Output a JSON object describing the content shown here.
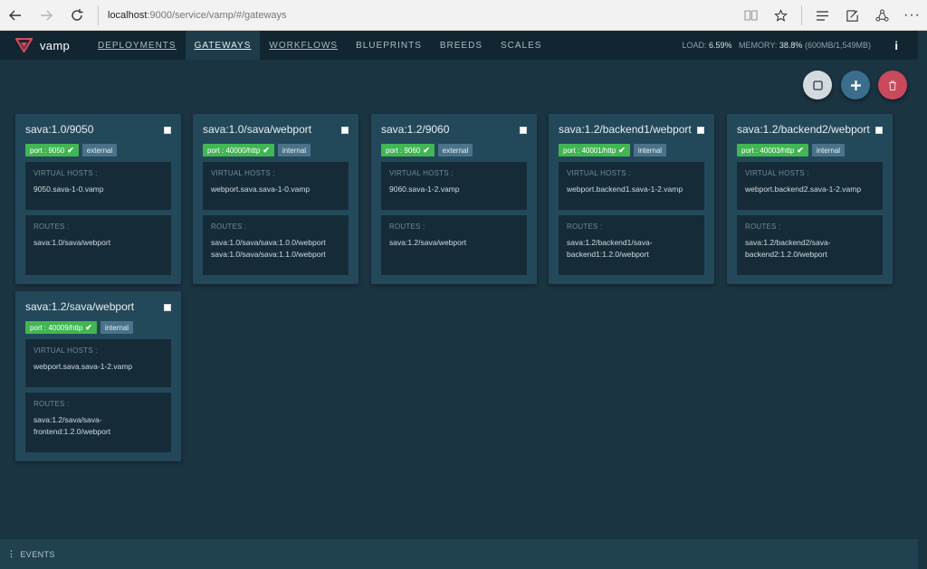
{
  "browser": {
    "url_host": "localhost",
    "url_path": ":9000/service/vamp/#/gateways"
  },
  "app": {
    "logo_text": "vamp",
    "nav": [
      {
        "label": "DEPLOYMENTS",
        "underlined": true,
        "active": false
      },
      {
        "label": "GATEWAYS",
        "underlined": true,
        "active": true
      },
      {
        "label": "WORKFLOWS",
        "underlined": true,
        "active": false
      },
      {
        "label": "BLUEPRINTS",
        "underlined": false,
        "active": false
      },
      {
        "label": "BREEDS",
        "underlined": false,
        "active": false
      },
      {
        "label": "SCALES",
        "underlined": false,
        "active": false
      }
    ],
    "stats": {
      "load_label": "LOAD:",
      "load_value": "6.59%",
      "memory_label": "MEMORY:",
      "memory_value": "38.8%",
      "memory_detail": "(600MB/1,549MB)"
    },
    "events_label": "EVENTS"
  },
  "labels": {
    "virtual_hosts": "VIRTUAL HOSTS :",
    "routes": "ROUTES :"
  },
  "colors": {
    "background": "#1b3442",
    "card": "#23485a",
    "port_tag": "#41b653",
    "delete_button": "#c94a5c",
    "add_button": "#3a6e8c"
  },
  "gateways": [
    {
      "name": "sava:1.0/9050",
      "port": "port : 9050",
      "type": "external",
      "virtual_hosts": "9050.sava-1-0.vamp",
      "routes": "sava:1.0/sava/webport"
    },
    {
      "name": "sava:1.0/sava/webport",
      "port": "port : 40000/http",
      "type": "internal",
      "virtual_hosts": "webport.sava.sava-1-0.vamp",
      "routes": "sava:1.0/sava/sava:1.0.0/webport\nsava:1.0/sava/sava:1.1.0/webport"
    },
    {
      "name": "sava:1.2/9060",
      "port": "port : 9060",
      "type": "external",
      "virtual_hosts": "9060.sava-1-2.vamp",
      "routes": "sava:1.2/sava/webport"
    },
    {
      "name": "sava:1.2/backend1/webport",
      "port": "port : 40001/http",
      "type": "internal",
      "virtual_hosts": "webport.backend1.sava-1-2.vamp",
      "routes": "sava:1.2/backend1/sava-\nbackend1:1.2.0/webport"
    },
    {
      "name": "sava:1.2/backend2/webport",
      "port": "port : 40003/http",
      "type": "internal",
      "virtual_hosts": "webport.backend2.sava-1-2.vamp",
      "routes": "sava:1.2/backend2/sava-\nbackend2:1.2.0/webport"
    },
    {
      "name": "sava:1.2/sava/webport",
      "port": "port : 40009/http",
      "type": "internal",
      "virtual_hosts": "webport.sava.sava-1-2.vamp",
      "routes": "sava:1.2/sava/sava-\nfrontend:1.2.0/webport"
    }
  ]
}
